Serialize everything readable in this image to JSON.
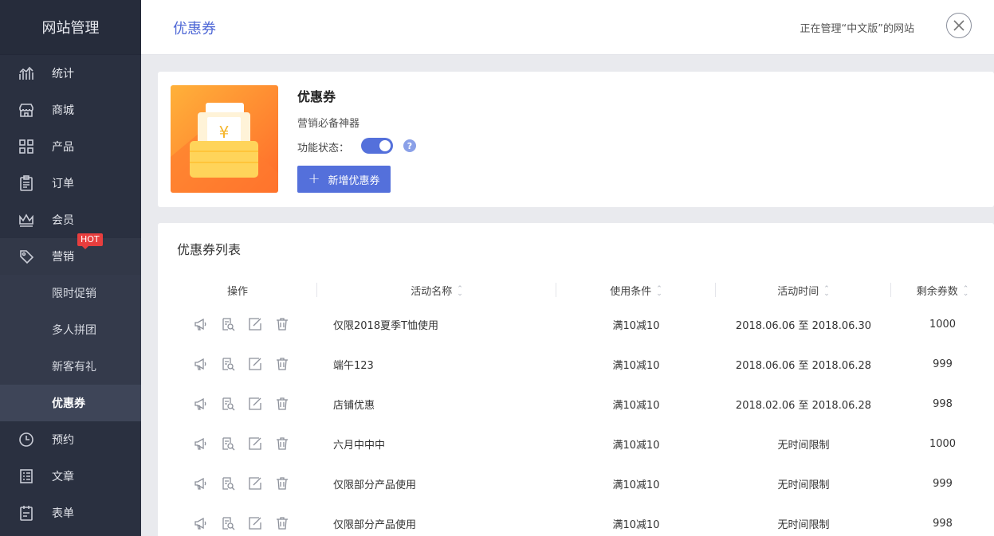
{
  "sidebar": {
    "brand": "网站管理",
    "items": [
      {
        "label": "统计",
        "icon": "chart-icon"
      },
      {
        "label": "商城",
        "icon": "store-icon"
      },
      {
        "label": "产品",
        "icon": "grid-icon"
      },
      {
        "label": "订单",
        "icon": "clipboard-icon"
      },
      {
        "label": "会员",
        "icon": "crown-icon"
      },
      {
        "label": "营销",
        "icon": "tag-icon",
        "badge": "HOT"
      }
    ],
    "sub_items": [
      {
        "label": "限时促销"
      },
      {
        "label": "多人拼团"
      },
      {
        "label": "新客有礼"
      },
      {
        "label": "优惠券"
      }
    ],
    "items_after": [
      {
        "label": "预约",
        "icon": "clock-icon"
      },
      {
        "label": "文章",
        "icon": "article-icon"
      },
      {
        "label": "表单",
        "icon": "form-icon"
      }
    ]
  },
  "header": {
    "title": "优惠券",
    "manage_text": "正在管理“中文版”的网站"
  },
  "feature": {
    "name": "优惠券",
    "desc": "营销必备神器",
    "status_label": "功能状态：",
    "status_on": true,
    "help": "?",
    "add_button": "新增优惠券",
    "image_symbol": "¥"
  },
  "list": {
    "title": "优惠券列表",
    "columns": [
      "操作",
      "活动名称",
      "使用条件",
      "活动时间",
      "剩余券数"
    ],
    "rows": [
      {
        "name": "仅限2018夏季T恤使用",
        "condition": "满10减10",
        "time": "2018.06.06 至 2018.06.30",
        "remaining": "1000"
      },
      {
        "name": "端午123",
        "condition": "满10减10",
        "time": "2018.06.06 至 2018.06.28",
        "remaining": "999"
      },
      {
        "name": "店铺优惠",
        "condition": "满10减10",
        "time": "2018.02.06 至 2018.06.28",
        "remaining": "998"
      },
      {
        "name": "六月中中中",
        "condition": "满10减10",
        "time": "无时间限制",
        "remaining": "1000"
      },
      {
        "name": "仅限部分产品使用",
        "condition": "满10减10",
        "time": "无时间限制",
        "remaining": "999"
      },
      {
        "name": "仅限部分产品使用",
        "condition": "满10减10",
        "time": "无时间限制",
        "remaining": "998"
      }
    ]
  },
  "colors": {
    "sidebar_bg": "#2a3040",
    "accent": "#5470db",
    "hot_badge": "#e83e3e"
  }
}
